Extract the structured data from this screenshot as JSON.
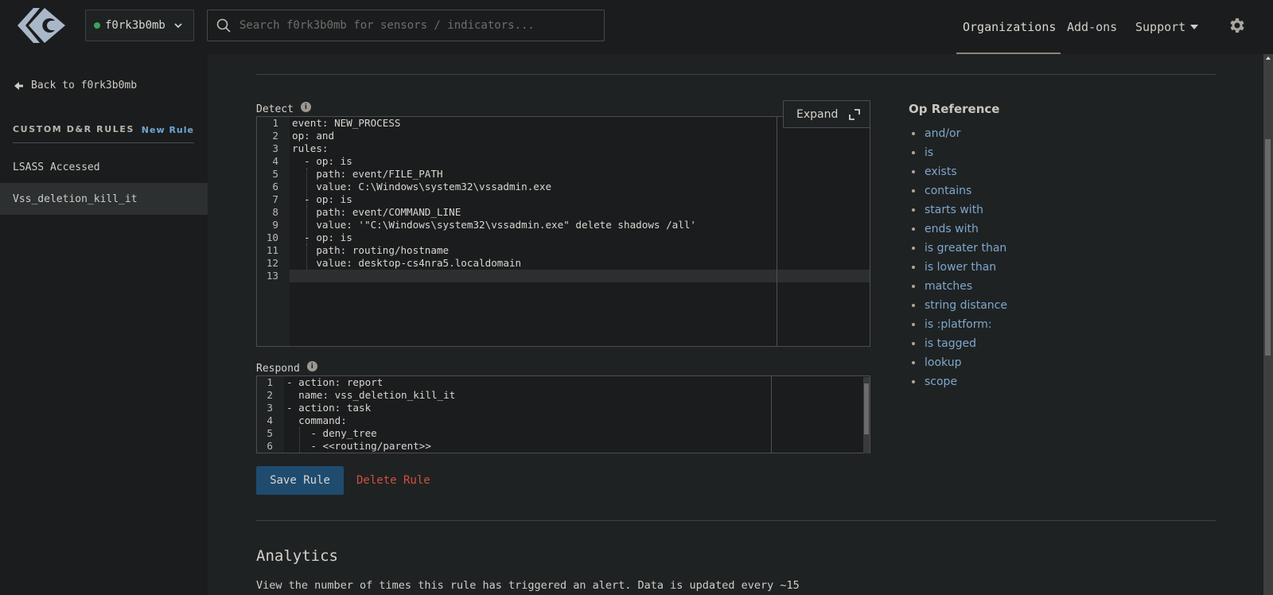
{
  "header": {
    "org_name": "f0rk3b0mb",
    "org_status_color": "#3aa45a",
    "search_placeholder": "Search f0rk3b0mb for sensors / indicators...",
    "nav": [
      {
        "label": "Organizations",
        "active": true
      },
      {
        "label": "Add-ons",
        "active": false
      },
      {
        "label": "Support",
        "active": false
      }
    ],
    "settings_icon": "gear-icon"
  },
  "sidebar": {
    "back_label": "Back to f0rk3b0mb",
    "section_title": "CUSTOM D&R RULES",
    "new_rule_label": "New Rule",
    "rules": [
      {
        "label": "LSASS Accessed",
        "selected": false
      },
      {
        "label": "Vss_deletion_kill_it",
        "selected": true
      }
    ]
  },
  "detect": {
    "label": "Detect",
    "expand_label": "Expand",
    "lines": [
      "event: NEW_PROCESS",
      "op: and",
      "rules:",
      "  - op: is",
      "    path: event/FILE_PATH",
      "    value: C:\\Windows\\system32\\vssadmin.exe",
      "  - op: is",
      "    path: event/COMMAND_LINE",
      "    value: '\"C:\\Windows\\system32\\vssadmin.exe\" delete shadows /all'",
      "  - op: is",
      "    path: routing/hostname",
      "    value: desktop-cs4nra5.localdomain",
      ""
    ],
    "current_line": 13
  },
  "respond": {
    "label": "Respond",
    "lines": [
      "- action: report",
      "  name: vss_deletion_kill_it",
      "- action: task",
      "  command:",
      "    - deny_tree",
      "    - <<routing/parent>>"
    ]
  },
  "op_reference": {
    "title": "Op Reference",
    "items": [
      "and/or",
      "is",
      "exists",
      "contains",
      "starts with",
      "ends with",
      "is greater than",
      "is lower than",
      "matches",
      "string distance",
      "is :platform:",
      "is tagged",
      "lookup",
      "scope"
    ]
  },
  "actions": {
    "save_label": "Save Rule",
    "delete_label": "Delete Rule"
  },
  "analytics": {
    "title": "Analytics",
    "description": "View the number of times this rule has triggered an alert. Data is updated every ~15"
  }
}
